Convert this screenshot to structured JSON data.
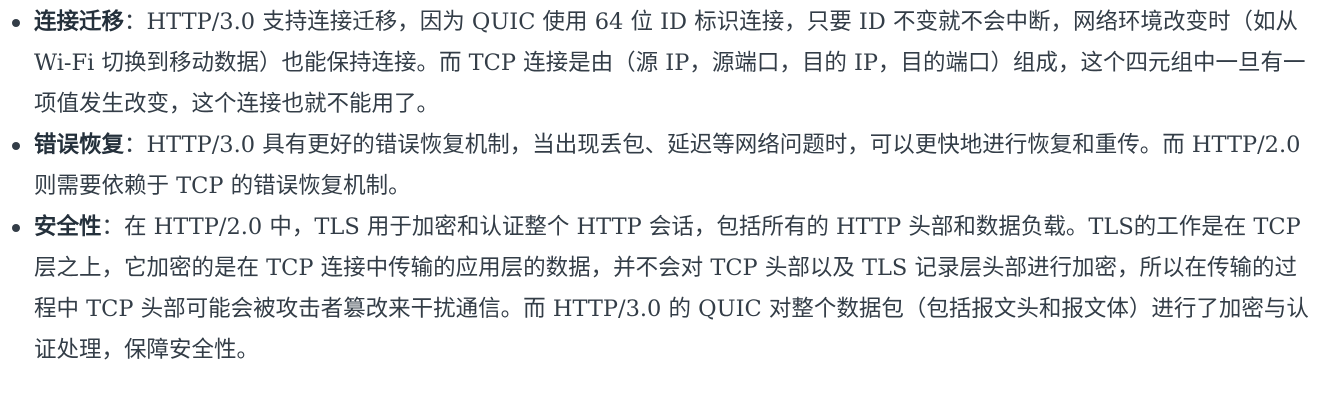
{
  "items": [
    {
      "term": "连接迁移",
      "separator": "：",
      "text": "HTTP/3.0 支持连接迁移，因为 QUIC 使用 64 位 ID 标识连接，只要 ID 不变就不会中断，网络环境改变时（如从 Wi-Fi 切换到移动数据）也能保持连接。而 TCP 连接是由（源 IP，源端口，目的 IP，目的端口）组成，这个四元组中一旦有一项值发生改变，这个连接也就不能用了。"
    },
    {
      "term": "错误恢复",
      "separator": "：",
      "text": "HTTP/3.0 具有更好的错误恢复机制，当出现丢包、延迟等网络问题时，可以更快地进行恢复和重传。而 HTTP/2.0 则需要依赖于 TCP 的错误恢复机制。"
    },
    {
      "term": "安全性",
      "separator": "：",
      "text": "在 HTTP/2.0 中，TLS 用于加密和认证整个 HTTP 会话，包括所有的 HTTP 头部和数据负载。TLS的工作是在 TCP 层之上，它加密的是在 TCP 连接中传输的应用层的数据，并不会对 TCP 头部以及 TLS 记录层头部进行加密，所以在传输的过程中 TCP 头部可能会被攻击者篡改来干扰通信。而 HTTP/3.0 的 QUIC 对整个数据包（包括报文头和报文体）进行了加密与认证处理，保障安全性。"
    }
  ]
}
